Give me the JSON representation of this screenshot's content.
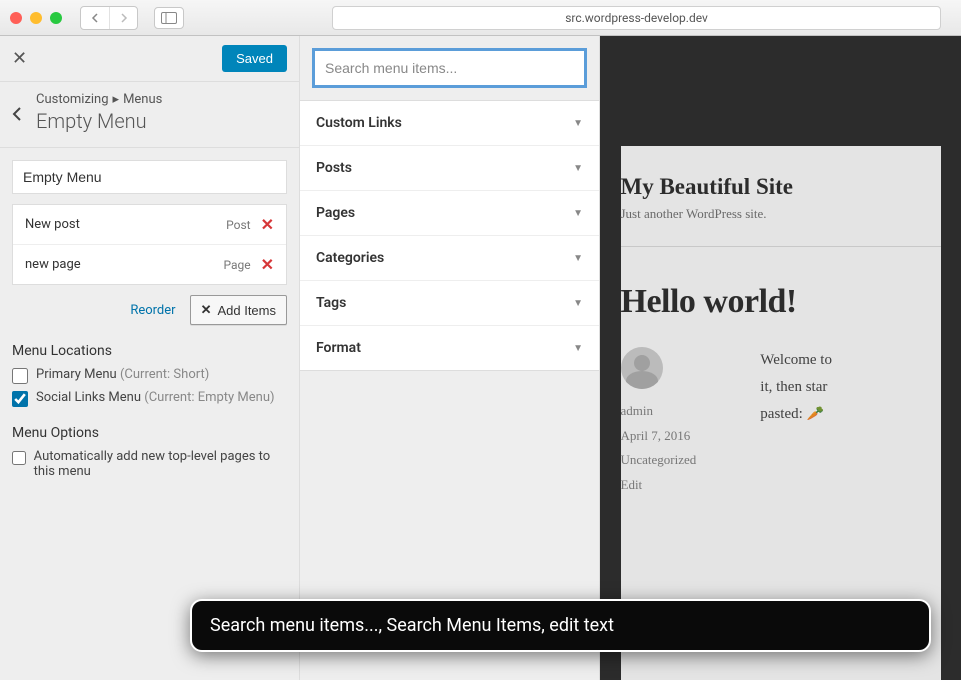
{
  "browser": {
    "url": "src.wordpress-develop.dev"
  },
  "customizer": {
    "saved_label": "Saved",
    "breadcrumb_root": "Customizing",
    "breadcrumb_section": "Menus",
    "title": "Empty Menu",
    "menu_name": "Empty Menu",
    "menu_items": [
      {
        "label": "New post",
        "type": "Post"
      },
      {
        "label": "new page",
        "type": "Page"
      }
    ],
    "reorder_label": "Reorder",
    "add_items_label": "Add Items",
    "locations_heading": "Menu Locations",
    "locations": [
      {
        "label": "Primary Menu",
        "current": "(Current: Short)",
        "checked": false
      },
      {
        "label": "Social Links Menu",
        "current": "(Current: Empty Menu)",
        "checked": true
      }
    ],
    "options_heading": "Menu Options",
    "auto_add_label": "Automatically add new top-level pages to this menu"
  },
  "add_panel": {
    "search_placeholder": "Search menu items...",
    "sections": [
      "Custom Links",
      "Posts",
      "Pages",
      "Categories",
      "Tags",
      "Format"
    ]
  },
  "preview": {
    "site_title": "My Beautiful Site",
    "tagline": "Just another WordPress site.",
    "post_title": "Hello world!",
    "author": "admin",
    "date": "April 7, 2016",
    "category": "Uncategorized",
    "edit": "Edit",
    "excerpt1": "Welcome to",
    "excerpt2": "it, then star",
    "excerpt3": "pasted: ",
    "carrot": "🥕"
  },
  "voiceover": {
    "text": "Search menu items..., Search Menu Items, edit text"
  }
}
